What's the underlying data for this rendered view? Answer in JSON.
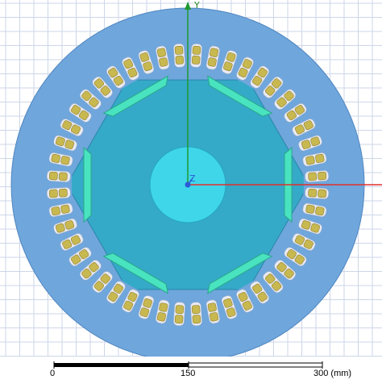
{
  "axes": {
    "y_label": "Y",
    "z_label": "Z",
    "x_axis_color": "#e0302a",
    "y_axis_color": "#1f9a2f",
    "z_axis_color": "#2a5ad8"
  },
  "colors": {
    "background": "#ffffff",
    "grid": "#cdd6e8",
    "stator": "#6fa6dc",
    "stator_edge": "#4f86c0",
    "rotor": "#35a9c8",
    "rotor_edge": "#2a86a6",
    "shaft": "#3fd6ea",
    "magnet": "#49e3c0",
    "magnet_edge": "#2aa88a",
    "slot_fill": "#e9eaf2",
    "coil": "#c8b850",
    "coil_edge": "#8f8130"
  },
  "model": {
    "slot_count": 48,
    "pole_count": 6
  },
  "scale_bar": {
    "tick_labels": [
      "0",
      "150",
      "300 (mm)"
    ]
  }
}
